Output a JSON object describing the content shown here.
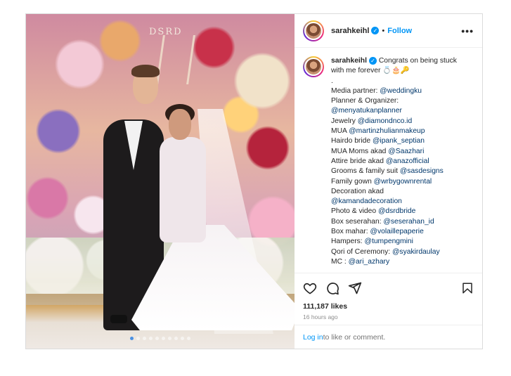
{
  "post": {
    "username": "sarahkeihl",
    "separator": "•",
    "follow_label": "Follow",
    "more_label": "•••",
    "media": {
      "watermark": "DSRD",
      "carousel_count": 10,
      "active_index": 0
    },
    "caption": {
      "username": "sarahkeihl",
      "first_line": "Congrats on being stuck",
      "lines": [
        {
          "pre": "with me forever 💍🎂🔑",
          "mention": "",
          "post": ""
        },
        {
          "pre": ".",
          "mention": "",
          "post": ""
        },
        {
          "pre": "Media partner: ",
          "mention": "@weddingku",
          "post": ""
        },
        {
          "pre": "Planner & Organizer:",
          "mention": "",
          "post": ""
        },
        {
          "pre": "",
          "mention": "@menyatukanplanner",
          "post": ""
        },
        {
          "pre": "Jewelry ",
          "mention": "@diamondnco.id",
          "post": ""
        },
        {
          "pre": "MUA ",
          "mention": "@martinzhulianmakeup",
          "post": ""
        },
        {
          "pre": "Hairdo bride ",
          "mention": "@ipank_septian",
          "post": ""
        },
        {
          "pre": "MUA Moms akad ",
          "mention": "@Saazhari",
          "post": ""
        },
        {
          "pre": "Attire bride akad ",
          "mention": "@anazofficial",
          "post": ""
        },
        {
          "pre": "Grooms & family suit ",
          "mention": "@sasdesigns",
          "post": ""
        },
        {
          "pre": "Family gown ",
          "mention": "@wrbygownrental",
          "post": ""
        },
        {
          "pre": "Decoration akad",
          "mention": "",
          "post": ""
        },
        {
          "pre": "",
          "mention": "@kamandadecoration",
          "post": ""
        },
        {
          "pre": "Photo & video ",
          "mention": "@dsrdbride",
          "post": ""
        },
        {
          "pre": "Box seserahan: ",
          "mention": "@seserahan_id",
          "post": ""
        },
        {
          "pre": "Box mahar: ",
          "mention": "@volaillepaperie",
          "post": ""
        },
        {
          "pre": "Hampers: ",
          "mention": "@tumpengmini",
          "post": ""
        },
        {
          "pre": "Qori of Ceremony: ",
          "mention": "@syakirdaulay",
          "post": ""
        },
        {
          "pre": "MC : ",
          "mention": "@ari_azhary",
          "post": ""
        }
      ]
    },
    "actions": {
      "like": "heart-icon",
      "comment": "comment-icon",
      "share": "share-icon",
      "save": "bookmark-icon"
    },
    "likes": "111,187 likes",
    "time": "16 hours ago",
    "login": {
      "link": "Log in",
      "rest": " to like or comment."
    },
    "colors": {
      "accent": "#0095f6",
      "mention": "#00376b",
      "text": "#262626",
      "muted": "#8e8e8e"
    }
  }
}
